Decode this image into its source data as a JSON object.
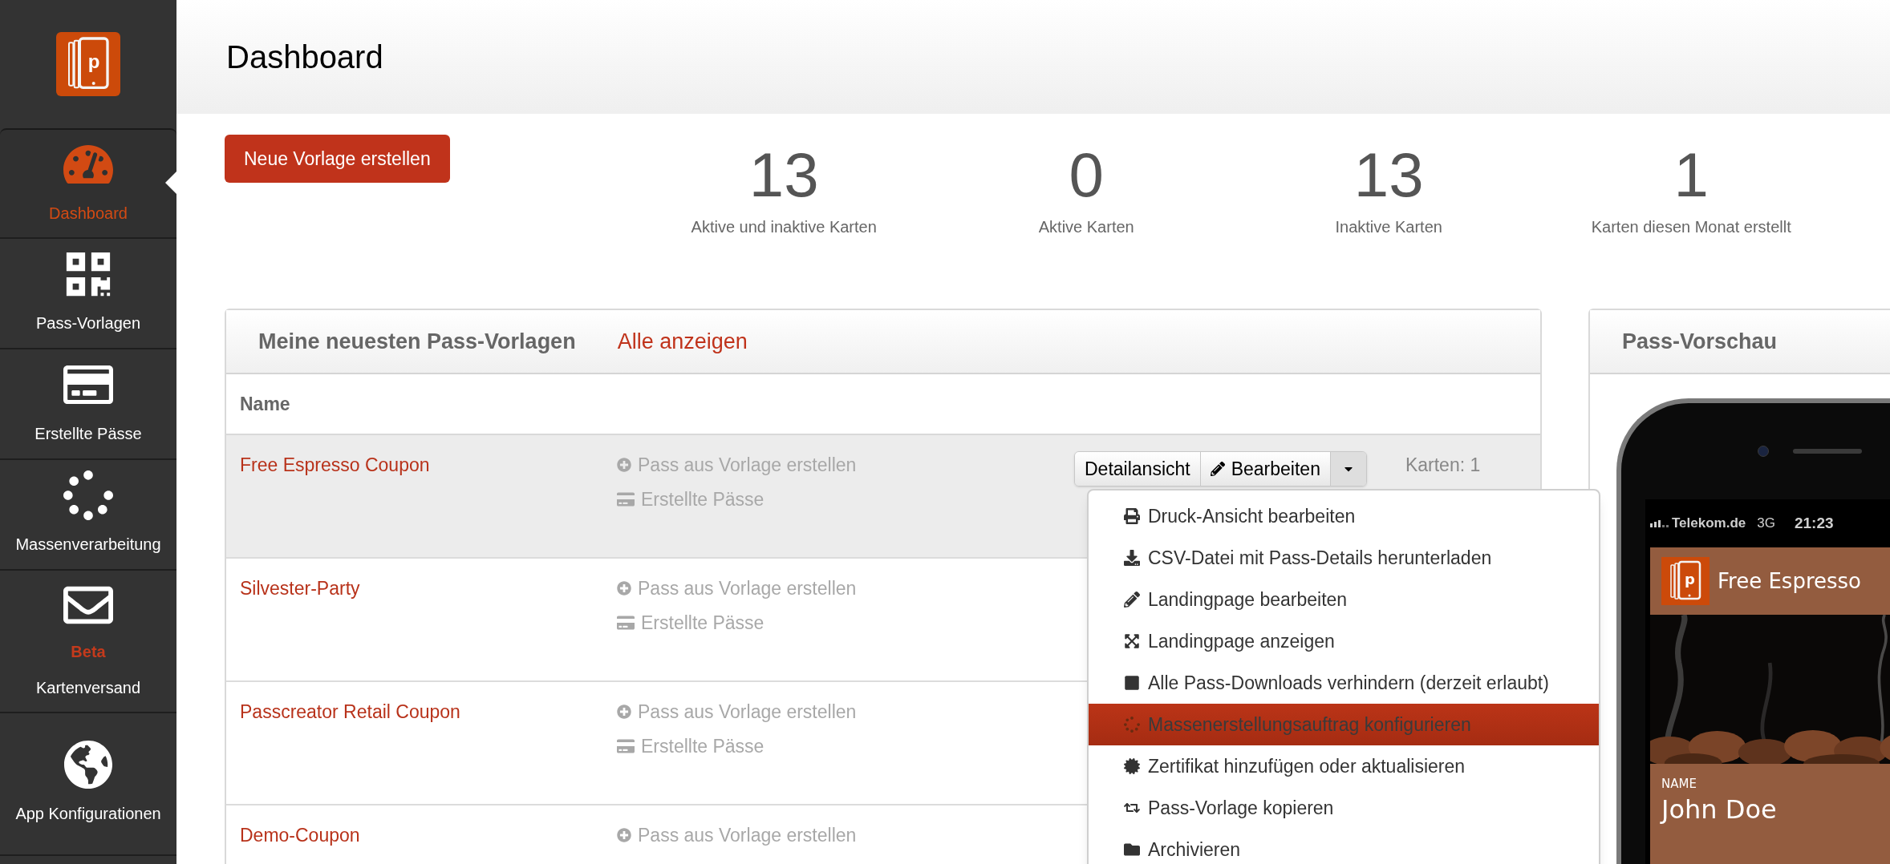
{
  "logo": {
    "letter": "p"
  },
  "sidebar": {
    "items": [
      {
        "label": "Dashboard",
        "selected": true
      },
      {
        "label": "Pass-Vorlagen",
        "selected": false
      },
      {
        "label": "Erstellte Pässe",
        "selected": false
      },
      {
        "label": "Massenverarbeitung",
        "selected": false
      },
      {
        "label": "Kartenversand",
        "badge": "Beta",
        "selected": false
      },
      {
        "label": "App Konfigurationen",
        "selected": false
      }
    ]
  },
  "header": {
    "title": "Dashboard"
  },
  "new_template_button": "Neue Vorlage erstellen",
  "stats": [
    {
      "value": "13",
      "label": "Aktive und inaktive Karten"
    },
    {
      "value": "0",
      "label": "Aktive Karten"
    },
    {
      "value": "13",
      "label": "Inaktive Karten"
    },
    {
      "value": "1",
      "label": "Karten diesen Monat erstellt"
    }
  ],
  "templates_panel": {
    "title": "Meine neuesten Pass-Vorlagen",
    "link": "Alle anzeigen",
    "columns": [
      "Name"
    ],
    "rows": [
      {
        "name": "Free Espresso Coupon",
        "highlighted": true,
        "create": "Pass aus Vorlage erstellen",
        "passes": "Erstellte Pässe",
        "buttons": {
          "detail": "Detailansicht",
          "edit": "Bearbeiten"
        },
        "count": "Karten: 1"
      },
      {
        "name": "Silvester-Party",
        "highlighted": false,
        "create": "Pass aus Vorlage erstellen",
        "passes": "Erstellte Pässe"
      },
      {
        "name": "Passcreator Retail Coupon",
        "highlighted": false,
        "create": "Pass aus Vorlage erstellen",
        "passes": "Erstellte Pässe"
      },
      {
        "name": "Demo-Coupon",
        "highlighted": false,
        "create": "Pass aus Vorlage erstellen"
      }
    ]
  },
  "dropdown": {
    "items": [
      {
        "label": "Druck-Ansicht bearbeiten",
        "selected": false
      },
      {
        "label": "CSV-Datei mit Pass-Details herunterladen",
        "selected": false
      },
      {
        "label": "Landingpage bearbeiten",
        "selected": false
      },
      {
        "label": "Landingpage anzeigen",
        "selected": false
      },
      {
        "label": "Alle Pass-Downloads verhindern (derzeit erlaubt)",
        "selected": false
      },
      {
        "label": "Massenerstellungsauftrag konfigurieren",
        "selected": true
      },
      {
        "label": "Zertifikat hinzufügen oder aktualisieren",
        "selected": false
      },
      {
        "label": "Pass-Vorlage kopieren",
        "selected": false
      },
      {
        "label": "Archivieren",
        "selected": false
      }
    ]
  },
  "preview": {
    "title": "Pass-Vorschau",
    "logo_letter": "p",
    "carrier": "Telekom.de",
    "network": "3G",
    "time": "21:23",
    "pass_title": "Free Espresso",
    "field_label": "NAME",
    "field_value": "John Doe"
  }
}
